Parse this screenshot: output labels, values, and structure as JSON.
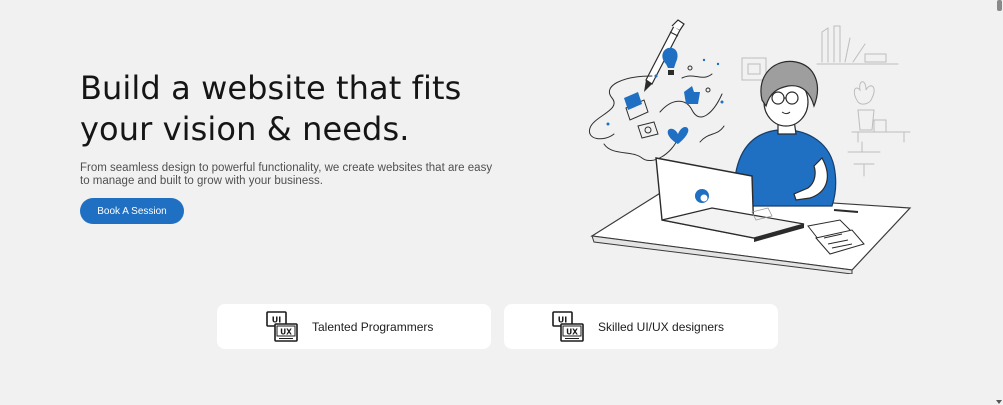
{
  "hero": {
    "title_line_1": "Build a website that fits",
    "title_line_2": "your vision & needs.",
    "subtitle": "From seamless design to powerful functionality, we create websites that are easy to manage and built to grow with your business.",
    "cta_label": "Book A Session"
  },
  "features": [
    {
      "label": "Talented Programmers",
      "icon": "ui-ux-icon",
      "icon_top_text": "UI",
      "icon_bottom_text": "UX"
    },
    {
      "label": "Skilled UI/UX designers",
      "icon": "ui-ux-icon",
      "icon_top_text": "UI",
      "icon_bottom_text": "UX"
    }
  ],
  "colors": {
    "background": "#f1f1f1",
    "accent": "#1f6fc2",
    "card": "#ffffff",
    "text": "#151515"
  }
}
